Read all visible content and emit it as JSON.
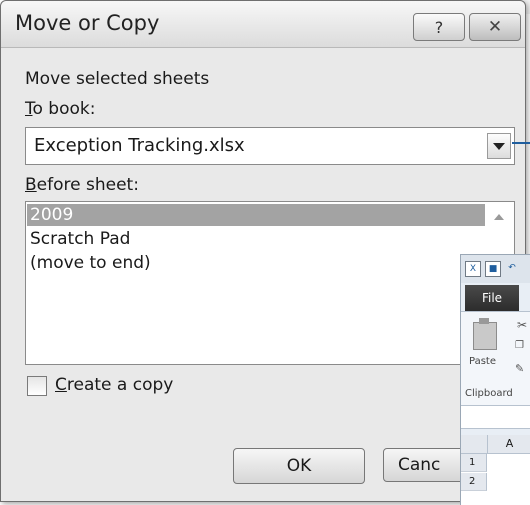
{
  "dialog": {
    "title": "Move or Copy",
    "help_label": "?",
    "move_selected_label": "Move selected sheets",
    "to_book_label": "To book:",
    "to_book_value": "Exception Tracking.xlsx",
    "before_sheet_label": "Before sheet:",
    "sheets": [
      "2009",
      "Scratch Pad",
      "(move to end)"
    ],
    "selected_sheet": "2009",
    "create_copy_label": "Create a copy",
    "create_copy_checked": false,
    "ok_label": "OK",
    "cancel_label": "Canc"
  },
  "excel": {
    "file_tab": "File",
    "paste_label": "Paste",
    "clipboard_label": "Clipboard",
    "column_a": "A",
    "rows": [
      "1",
      "2"
    ]
  },
  "colors": {
    "selection": "#a3a3a3",
    "callout": "#1f5e9e",
    "file_tab": "#2c2c2c"
  }
}
